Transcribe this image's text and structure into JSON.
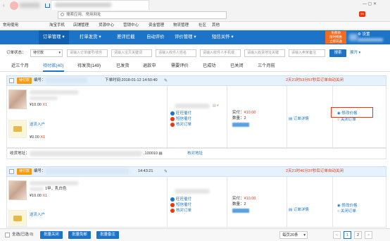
{
  "browser": {
    "address_placeholder": "搜索应用、常用网址",
    "bookmarks_label": "常用网址",
    "bookmark_items": [
      "常用使用",
      "淘宝手机",
      "店铺管理",
      "货源中心",
      "营销中心",
      "资金管理",
      "物流管理",
      "社区",
      "其他"
    ]
  },
  "nav": {
    "items": [
      "订单管理",
      "打单发货",
      "差评拦截",
      "自动评价",
      "评价管理",
      "短信关怀"
    ],
    "promo_line1": "免费领",
    "promo_line2": "限时特惠",
    "promo_line3": "立即开通",
    "settings": "设置"
  },
  "filter": {
    "status_label": "订单状态：",
    "status_value": "待付款",
    "inputs": [
      "请输入订单编号/收件",
      "请输入宝贝关键词",
      "请输入收件人姓名",
      "请输入收件人手机或",
      "请输入收货地址关键",
      "请输入卖家备注"
    ],
    "search": "搜索",
    "expand": "展开"
  },
  "tabs": [
    "近三个月",
    "待付款(40)",
    "待发货(149)",
    "已发货",
    "退款中",
    "需要评价",
    "已成功",
    "已关闭",
    "三个月前"
  ],
  "orders": [
    {
      "status": "待付款",
      "number_label": "编号：",
      "time_label": "下单时间:2018-01-12 14:50:40",
      "countdown": "2天21时53分57秒后订单自动关闭",
      "price": "¥10.00",
      "qty": "X1",
      "gift_title": "送流入户",
      "gift_price": "¥0.00",
      "gift_qty": "X1",
      "actions": [
        "旺旺催付",
        "短信催付",
        "核对订单"
      ],
      "paid_label": "实付：",
      "paid_value": "¥10.00",
      "count_label": "数量：2",
      "detail": "订单详情",
      "modify_price": "修改价格",
      "close_order": "关闭订单",
      "address_label": "收货地址：",
      "postcode": "100010",
      "verify_address": "核对地址"
    },
    {
      "status": "待付款",
      "number_label": "编号：",
      "time_label": "14:43:21",
      "countdown": "2天21时46分37秒后订单自动关闭",
      "item_title": "1甲，乳白色",
      "price": "¥10.00",
      "qty": "X1",
      "gift_title": "送流入户",
      "actions": [
        "旺旺催付",
        "短信催付",
        "核对订单"
      ],
      "paid_label": "实付：",
      "paid_value": "¥10.00",
      "count_label": "数量：2",
      "detail": "订单详情",
      "modify_price": "修改价格",
      "close_order": "关闭订单"
    }
  ],
  "footer": {
    "select_all": "全选(已选 0)",
    "buttons": [
      "批量关闭",
      "批量免邮",
      "批量备注"
    ],
    "page_size": "每页20条",
    "pages": [
      "1",
      "2"
    ],
    "prev": "<",
    "next": ">"
  }
}
